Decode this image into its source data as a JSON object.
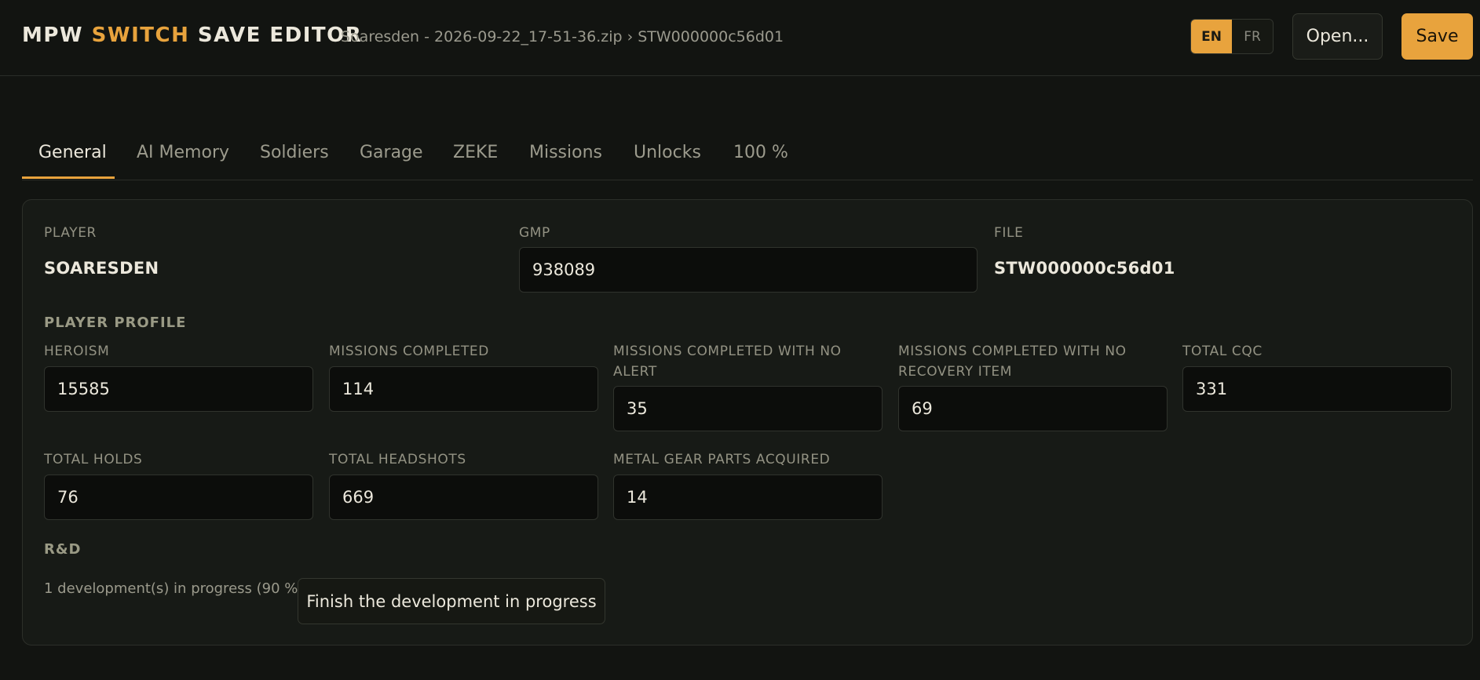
{
  "header": {
    "brand_part1": "MPW ",
    "brand_accent": "SWITCH",
    "brand_part2": " SAVE EDITOR",
    "breadcrumb": "Soaresden - 2026-09-22_17-51-36.zip › STW000000c56d01",
    "lang_en": "EN",
    "lang_fr": "FR",
    "open_label": "Open...",
    "save_label": "Save"
  },
  "tabs": [
    {
      "label": "General",
      "active": true
    },
    {
      "label": "AI Memory"
    },
    {
      "label": "Soldiers"
    },
    {
      "label": "Garage"
    },
    {
      "label": "ZEKE"
    },
    {
      "label": "Missions"
    },
    {
      "label": "Unlocks"
    },
    {
      "label": "100 %"
    }
  ],
  "general": {
    "player_label": "PLAYER",
    "player_value": "SOARESDEN",
    "gmp_label": "GMP",
    "gmp_value": "938089",
    "file_label": "FILE",
    "file_value": "STW000000c56d01"
  },
  "profile": {
    "section_title": "PLAYER PROFILE",
    "fields": [
      {
        "label": "HEROISM",
        "value": "15585"
      },
      {
        "label": "MISSIONS COMPLETED",
        "value": "114"
      },
      {
        "label": "MISSIONS COMPLETED WITH NO ALERT",
        "value": "35"
      },
      {
        "label": "MISSIONS COMPLETED WITH NO RECOVERY ITEM",
        "value": "69"
      },
      {
        "label": "TOTAL CQC",
        "value": "331"
      },
      {
        "label": "TOTAL HOLDS",
        "value": "76"
      },
      {
        "label": "TOTAL HEADSHOTS",
        "value": "669"
      },
      {
        "label": "METAL GEAR PARTS ACQUIRED",
        "value": "14"
      }
    ]
  },
  "rnd": {
    "section_title": "R&D",
    "status_text": "1 development(s) in progress (90 %)",
    "finish_label": "Finish the development in progress"
  },
  "colors": {
    "accent": "#e8a33d",
    "background": "#121411",
    "panel": "#171a16"
  }
}
